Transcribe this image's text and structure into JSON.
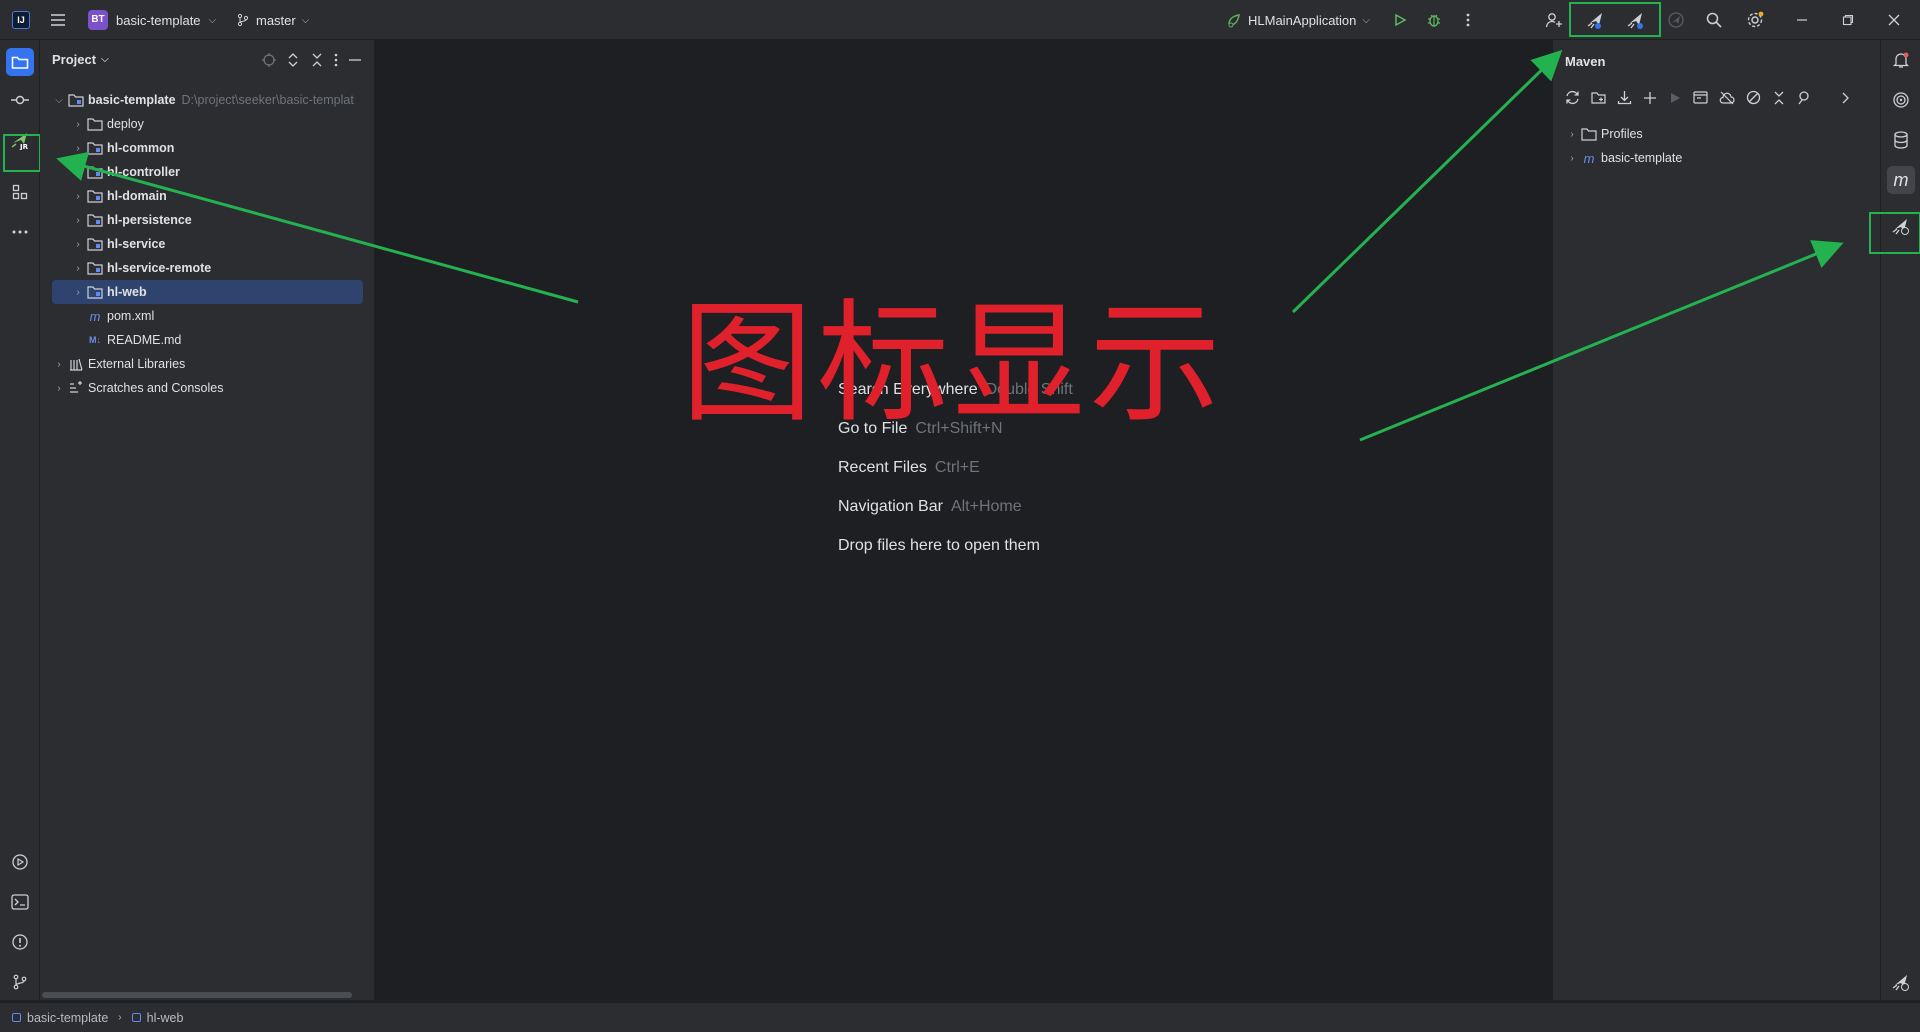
{
  "window": {
    "project_badge": "BT",
    "project_name": "basic-template",
    "branch": "master",
    "run_config": "HLMainApplication",
    "app_logo_text": "IJ"
  },
  "project_panel": {
    "title": "Project",
    "root": {
      "name": "basic-template",
      "path": "D:\\project\\seeker\\basic-templat"
    },
    "items": [
      {
        "label": "deploy",
        "bold": false
      },
      {
        "label": "hl-common",
        "bold": true
      },
      {
        "label": "hl-controller",
        "bold": true
      },
      {
        "label": "hl-domain",
        "bold": true
      },
      {
        "label": "hl-persistence",
        "bold": true
      },
      {
        "label": "hl-service",
        "bold": true
      },
      {
        "label": "hl-service-remote",
        "bold": true
      },
      {
        "label": "hl-web",
        "bold": true
      }
    ],
    "files": [
      {
        "label": "pom.xml",
        "icon": "m"
      },
      {
        "label": "README.md",
        "icon": "M↓"
      }
    ],
    "extras": [
      "External Libraries",
      "Scratches and Consoles"
    ]
  },
  "editor": {
    "hints": [
      {
        "label": "Search Everywhere",
        "key": "Double Shift"
      },
      {
        "label": "Go to File",
        "key": "Ctrl+Shift+N"
      },
      {
        "label": "Recent Files",
        "key": "Ctrl+E"
      },
      {
        "label": "Navigation Bar",
        "key": "Alt+Home"
      },
      {
        "label": "Drop files here to open them",
        "key": ""
      }
    ],
    "overlay_text": "图标显示"
  },
  "maven_panel": {
    "title": "Maven",
    "items": [
      {
        "label": "Profiles"
      },
      {
        "label": "basic-template"
      }
    ]
  },
  "statusbar": {
    "crumbs": [
      "basic-template",
      "hl-web"
    ]
  },
  "colors": {
    "accent": "#3574f0",
    "highlight_box": "#24b150",
    "overlay": "#e0202b",
    "selection": "#2e436e"
  }
}
